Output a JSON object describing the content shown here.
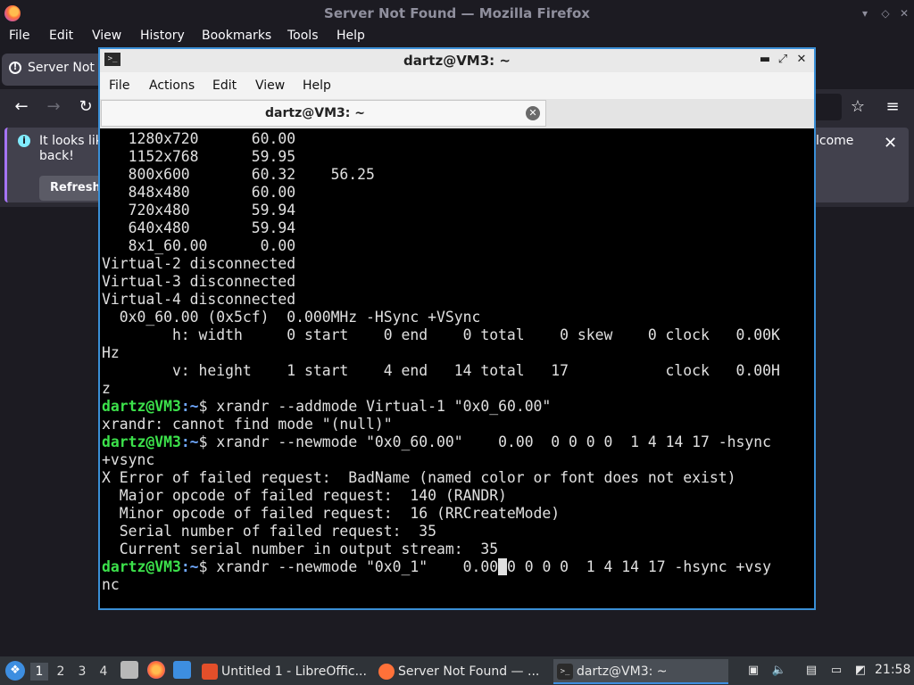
{
  "firefox": {
    "title": "Server Not Found — Mozilla Firefox",
    "menu": [
      "File",
      "Edit",
      "View",
      "History",
      "Bookmarks",
      "Tools",
      "Help"
    ],
    "tab_label": "Server Not F",
    "notification": {
      "line1": "It looks lik",
      "line2": "back!",
      "right_text": "lcome",
      "refresh_label": "Refresh"
    }
  },
  "terminal": {
    "title": "dartz@VM3: ~",
    "menu": [
      "File",
      "Actions",
      "Edit",
      "View",
      "Help"
    ],
    "tab_label": "dartz@VM3: ~",
    "prompt_user": "dartz@VM3",
    "prompt_path": ":~",
    "prompt_symbol": "$ ",
    "lines": [
      "   1280x720      60.00",
      "   1152x768      59.95",
      "   800x600       60.32    56.25",
      "   848x480       60.00",
      "   720x480       59.94",
      "   640x480       59.94",
      "   8x1_60.00      0.00",
      "Virtual-2 disconnected",
      "Virtual-3 disconnected",
      "Virtual-4 disconnected",
      "  0x0_60.00 (0x5cf)  0.000MHz -HSync +VSync",
      "        h: width     0 start    0 end    0 total    0 skew    0 clock   0.00K",
      "Hz",
      "        v: height    1 start    4 end   14 total   17           clock   0.00H",
      "z",
      {
        "prompt": true,
        "cmd": "xrandr --addmode Virtual-1 \"0x0_60.00\""
      },
      "xrandr: cannot find mode \"(null)\"",
      {
        "prompt": true,
        "cmd": "xrandr --newmode \"0x0_60.00\"    0.00  0 0 0 0  1 4 14 17 -hsync"
      },
      "+vsync",
      "X Error of failed request:  BadName (named color or font does not exist)",
      "  Major opcode of failed request:  140 (RANDR)",
      "  Minor opcode of failed request:  16 (RRCreateMode)",
      "  Serial number of failed request:  35",
      "  Current serial number in output stream:  35",
      {
        "prompt": true,
        "cmd_before": "xrandr --newmode \"0x0_1\"    0.00",
        "cursor_char": " ",
        "cmd_after": "0 0 0 0  1 4 14 17 -hsync +vsy"
      },
      "nc"
    ]
  },
  "taskbar": {
    "workspaces": [
      "1",
      "2",
      "3",
      "4"
    ],
    "tasks": [
      {
        "label": "Untitled 1 - LibreOffic...",
        "icon": "libreoffice-writer-icon",
        "color": "#e34f2a"
      },
      {
        "label": "Server Not Found — ...",
        "icon": "firefox-icon",
        "color": "#ff7139"
      },
      {
        "label": "dartz@VM3: ~",
        "icon": "terminal-icon",
        "color": "#2b2b2b"
      }
    ],
    "clock": "21:58"
  },
  "colors": {
    "accent": "#3d8ee0",
    "prompt_user": "#3ce14b",
    "prompt_path": "#6fa8ff"
  }
}
